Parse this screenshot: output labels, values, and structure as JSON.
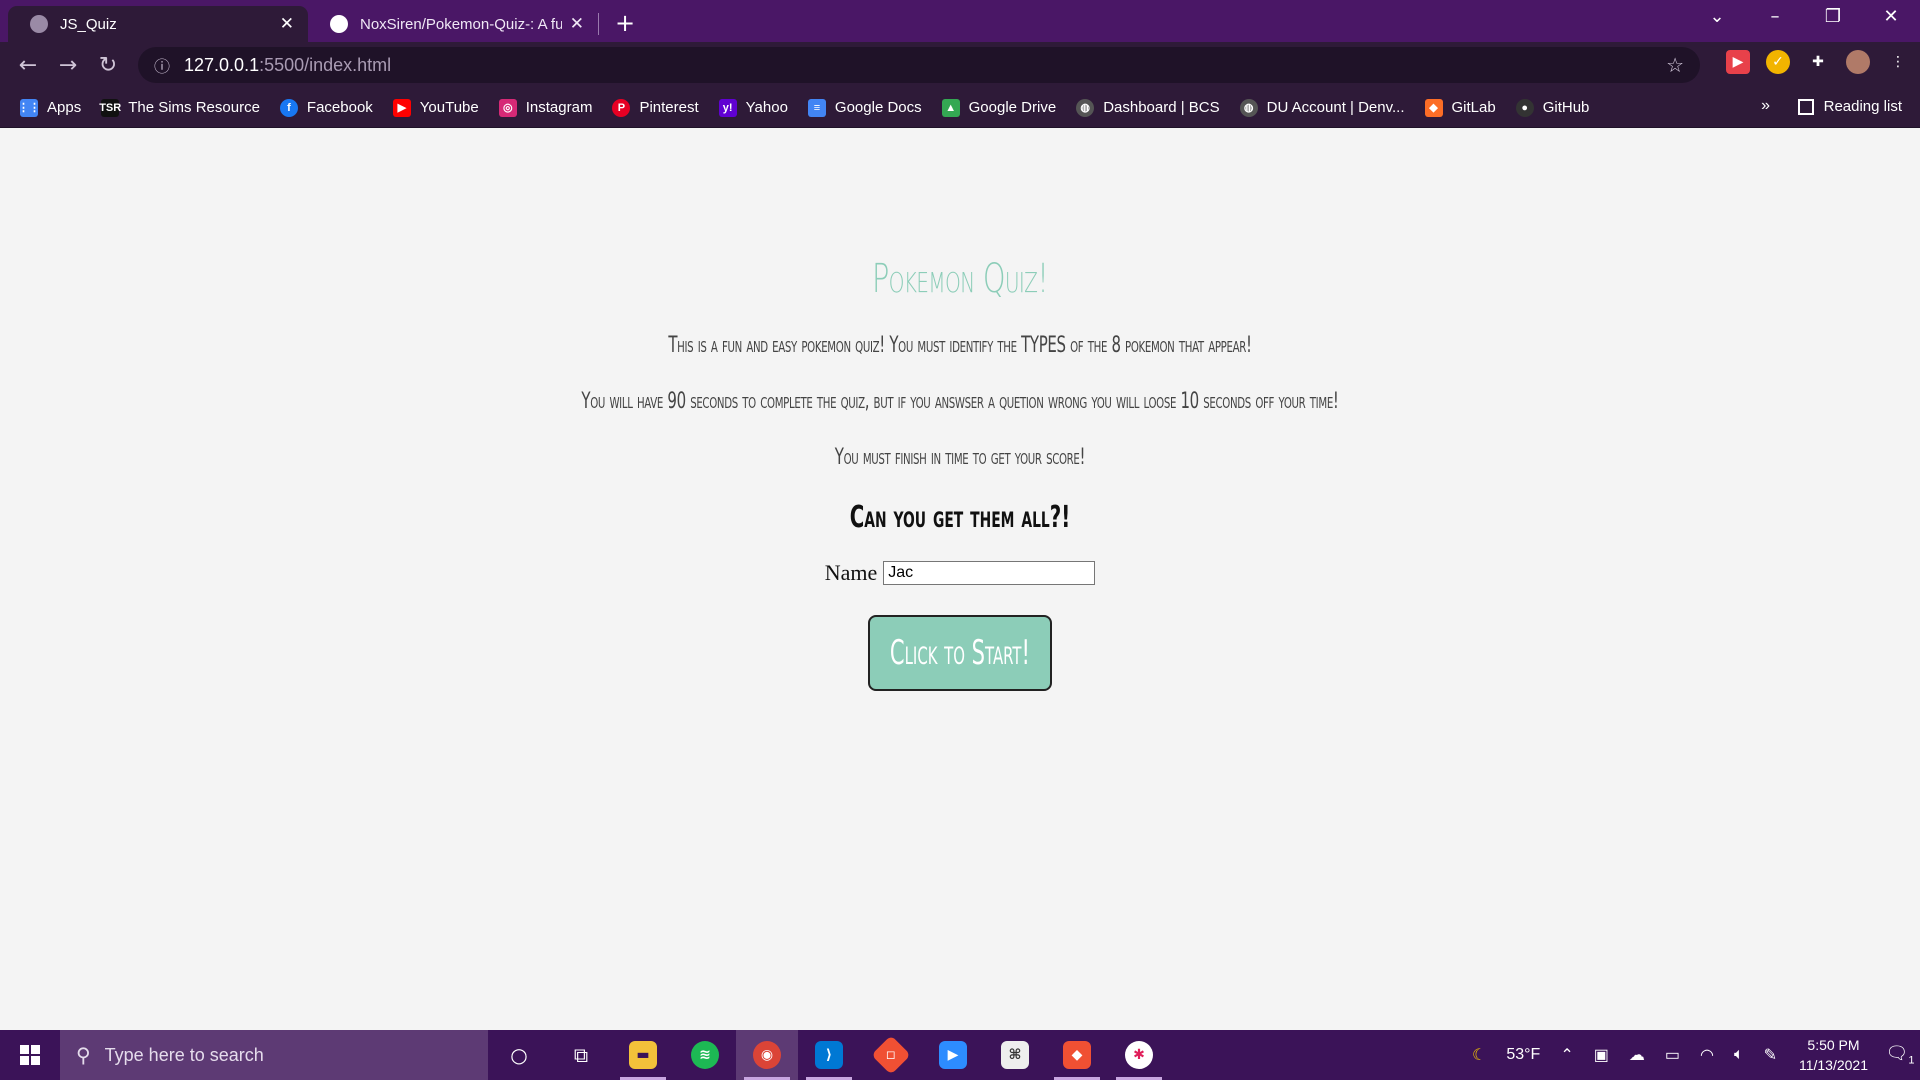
{
  "browser": {
    "tabs": [
      {
        "title": "JS_Quiz",
        "active": true
      },
      {
        "title": "NoxSiren/Pokemon-Quiz-: A fun",
        "active": false
      }
    ],
    "new_tab_label": "+",
    "url_host": "127.0.0.1",
    "url_path": ":5500/index.html"
  },
  "bookmarks": [
    {
      "label": "Apps",
      "icon": "apps-grid-icon",
      "color": "#4285f4"
    },
    {
      "label": "The Sims Resource",
      "icon": "tsr-icon",
      "color": "#111111"
    },
    {
      "label": "Facebook",
      "icon": "facebook-icon",
      "color": "#1877f2"
    },
    {
      "label": "YouTube",
      "icon": "youtube-icon",
      "color": "#ff0000"
    },
    {
      "label": "Instagram",
      "icon": "instagram-icon",
      "color": "#d62976"
    },
    {
      "label": "Pinterest",
      "icon": "pinterest-icon",
      "color": "#e60023"
    },
    {
      "label": "Yahoo",
      "icon": "yahoo-icon",
      "color": "#6001d2"
    },
    {
      "label": "Google Docs",
      "icon": "google-docs-icon",
      "color": "#4285f4"
    },
    {
      "label": "Google Drive",
      "icon": "google-drive-icon",
      "color": "#34a853"
    },
    {
      "label": "Dashboard | BCS",
      "icon": "globe-icon",
      "color": "#555555"
    },
    {
      "label": "DU Account | Denv...",
      "icon": "globe-icon",
      "color": "#555555"
    },
    {
      "label": "GitLab",
      "icon": "gitlab-icon",
      "color": "#fc6d26"
    },
    {
      "label": "GitHub",
      "icon": "github-icon",
      "color": "#333333"
    }
  ],
  "bookmarks_overflow": "»",
  "reading_list_label": "Reading list",
  "page": {
    "title": "Pokemon Quiz!",
    "intro_lines": [
      "This is a fun and easy pokemon quiz! You must identify the TYPES of the 8 pokemon that appear!",
      "You will have 90 seconds to complete the quiz, but if you answser a quetion wrong you will loose 10 seconds off your time!",
      "You must finish in time to get your score!"
    ],
    "challenge": "Can you get them all?!",
    "name_label": "Name",
    "name_value": "Jac",
    "start_button": "Click to Start!"
  },
  "taskbar": {
    "search_placeholder": "Type here to search",
    "temperature": "53°F",
    "time": "5:50 PM",
    "date": "11/13/2021",
    "notification_count": "1"
  },
  "colors": {
    "accent": "#8ccdb8",
    "tab_strip": "#4a1766",
    "toolbar": "#2e1a38",
    "taskbar": "#3b1358"
  }
}
